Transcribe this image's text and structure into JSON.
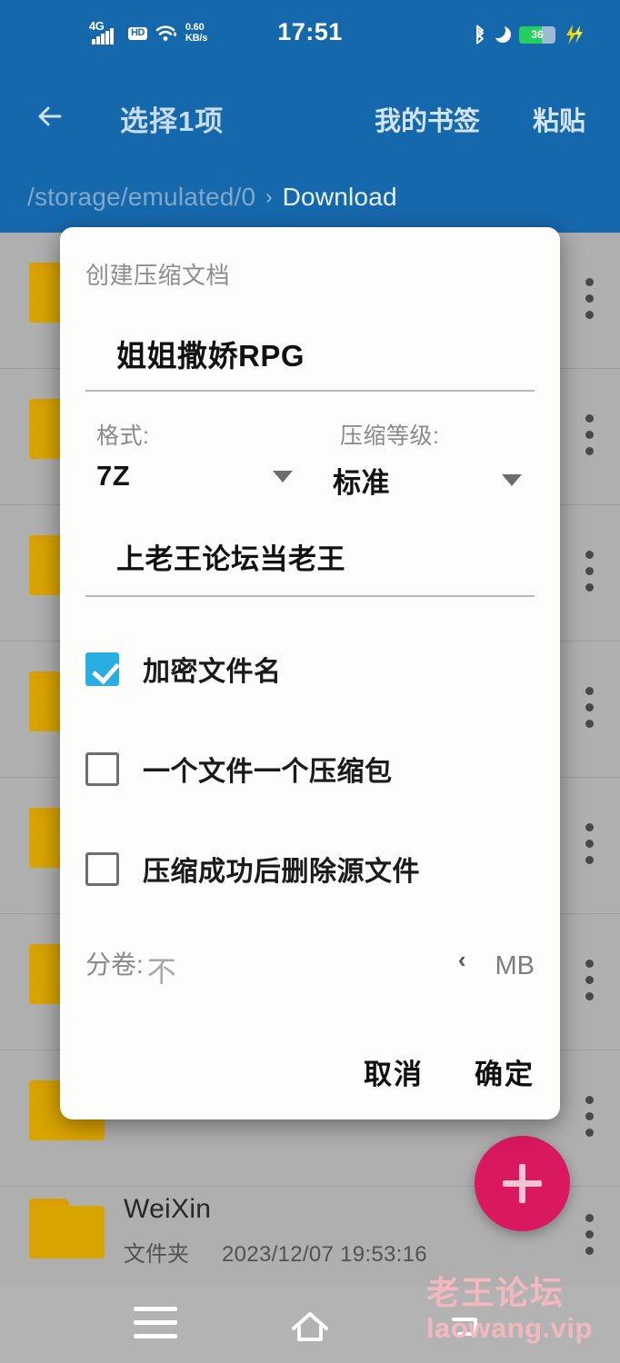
{
  "statusbar": {
    "network_type": "4G",
    "hd_badge": "HD",
    "net_speed_value": "0.60",
    "net_speed_unit": "KB/s",
    "clock": "17:51",
    "battery_percent": "36",
    "icons": [
      "signal-bars-icon",
      "hd-icon",
      "wifi-icon",
      "bluetooth-icon",
      "dnd-moon-icon",
      "battery-icon",
      "lightning-bolt-icon"
    ],
    "accent_blue": "#1668ad"
  },
  "toolbar": {
    "back_label": "←",
    "title": "选择1项",
    "bookmark_label": "我的书签",
    "paste_label": "粘贴"
  },
  "breadcrumb": {
    "path": "/storage/emulated/0",
    "separator": "›",
    "current": "Download"
  },
  "filelist": {
    "rows": [
      {
        "name": "",
        "type": "",
        "date": ""
      },
      {
        "name": "",
        "type": "",
        "date": ""
      },
      {
        "name": "",
        "type": "",
        "date": ""
      },
      {
        "name": "",
        "type": "",
        "date": ""
      },
      {
        "name": "",
        "type": "",
        "date": ""
      },
      {
        "name": "",
        "type": "",
        "date": ""
      },
      {
        "name": "",
        "type": "",
        "date": ""
      },
      {
        "name": "WeiXin",
        "type": "文件夹",
        "date": "2023/12/07 19:53:16"
      }
    ]
  },
  "dialog": {
    "title": "创建压缩文档",
    "archive_name": "姐姐撒娇RPG",
    "format": {
      "label": "格式:",
      "value": "7Z"
    },
    "level": {
      "label": "压缩等级:",
      "value": "标准"
    },
    "password": "上老王论坛当老王",
    "checkboxes": [
      {
        "label": "加密文件名",
        "checked": true
      },
      {
        "label": "一个文件一个压缩包",
        "checked": false
      },
      {
        "label": "压缩成功后删除源文件",
        "checked": false
      }
    ],
    "split": {
      "label": "分卷:",
      "value": "不",
      "chevron": "‹",
      "unit": "MB"
    },
    "cancel_label": "取消",
    "confirm_label": "确定",
    "checkbox_accent": "#29aee4"
  },
  "fab": {
    "label": "+",
    "color": "#da1860"
  },
  "navbar": {
    "menu": "menu-icon",
    "home": "home-icon",
    "back": "back-icon"
  },
  "watermark": {
    "line1": "老王论坛",
    "line2": "laowang.vip"
  }
}
